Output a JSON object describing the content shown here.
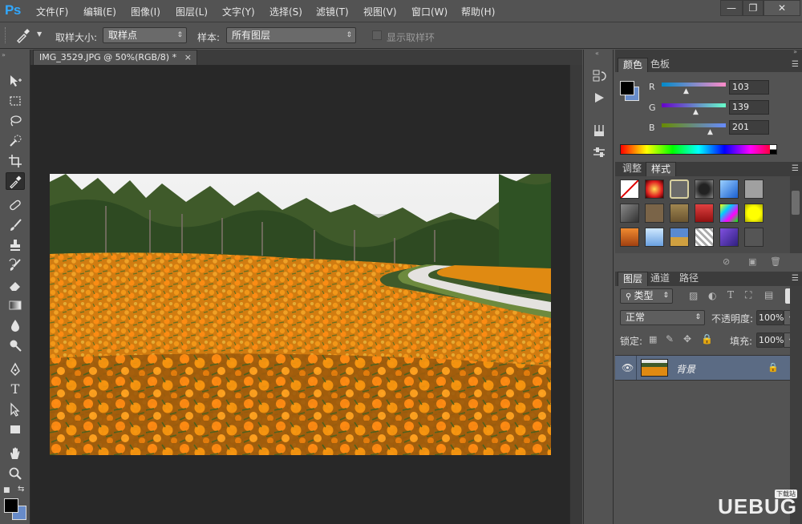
{
  "app": {
    "logo": "Ps",
    "menu": [
      "文件(F)",
      "编辑(E)",
      "图像(I)",
      "图层(L)",
      "文字(Y)",
      "选择(S)",
      "滤镜(T)",
      "视图(V)",
      "窗口(W)",
      "帮助(H)"
    ],
    "window_buttons": {
      "minimize": "—",
      "restore": "❐",
      "close": "✕"
    }
  },
  "options_bar": {
    "sample_size_label": "取样大小:",
    "sample_size_value": "取样点",
    "sample_label": "样本:",
    "sample_value": "所有图层",
    "show_ring_label": "显示取样环"
  },
  "document": {
    "tab_title": "IMG_3529.JPG @ 50%(RGB/8) *",
    "close": "×"
  },
  "color_panel": {
    "tabs": [
      "颜色",
      "色板"
    ],
    "r_label": "R",
    "g_label": "G",
    "b_label": "B",
    "r_value": "103",
    "g_value": "139",
    "b_value": "201",
    "foreground": "#000000",
    "background": "#678bc9"
  },
  "styles_panel": {
    "tabs": [
      "调整",
      "样式"
    ]
  },
  "layers_panel": {
    "tabs": [
      "图层",
      "通道",
      "路径"
    ],
    "filter_kind": "类型",
    "blend_mode": "正常",
    "opacity_label": "不透明度:",
    "opacity_value": "100%",
    "lock_label": "锁定:",
    "fill_label": "填充:",
    "fill_value": "100%",
    "layer_name": "背景"
  },
  "watermark": {
    "text": "UEBUG",
    "sub": "下载站"
  }
}
